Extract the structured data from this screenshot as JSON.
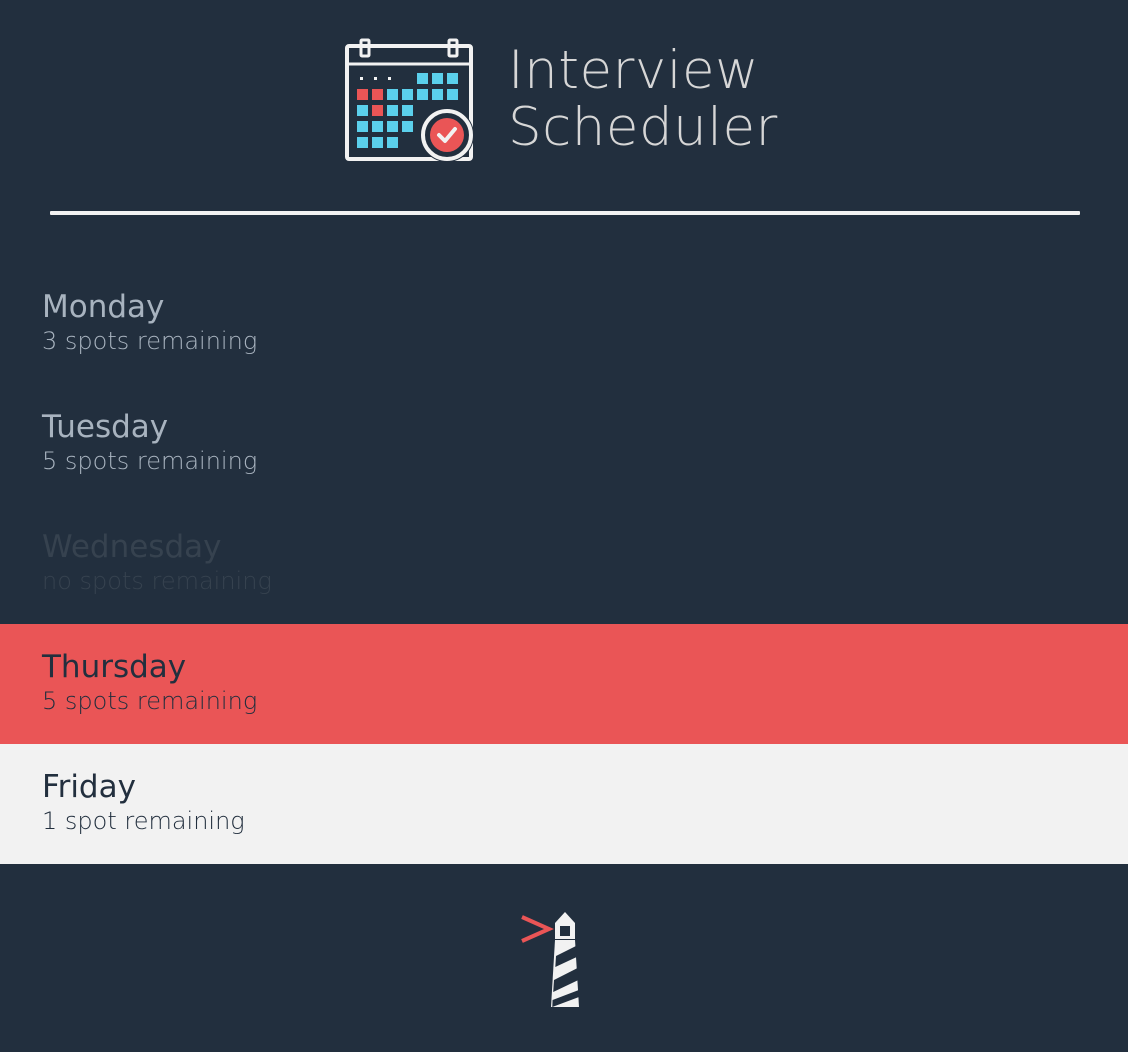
{
  "app": {
    "title_line1": "Interview",
    "title_line2": "Scheduler"
  },
  "icons": {
    "logo": "calendar-check-icon",
    "footer": "lighthouse-icon"
  },
  "colors": {
    "background": "#222f3e",
    "accent": "#ea5556",
    "highlight": "#f2f2f2",
    "calendar_cyan": "#5bd0ec"
  },
  "days": [
    {
      "name": "Monday",
      "spots": "3 spots remaining",
      "state": "normal"
    },
    {
      "name": "Tuesday",
      "spots": "5 spots remaining",
      "state": "normal"
    },
    {
      "name": "Wednesday",
      "spots": "no spots remaining",
      "state": "full"
    },
    {
      "name": "Thursday",
      "spots": "5 spots remaining",
      "state": "selected"
    },
    {
      "name": "Friday",
      "spots": "1 spot remaining",
      "state": "hovered"
    }
  ]
}
